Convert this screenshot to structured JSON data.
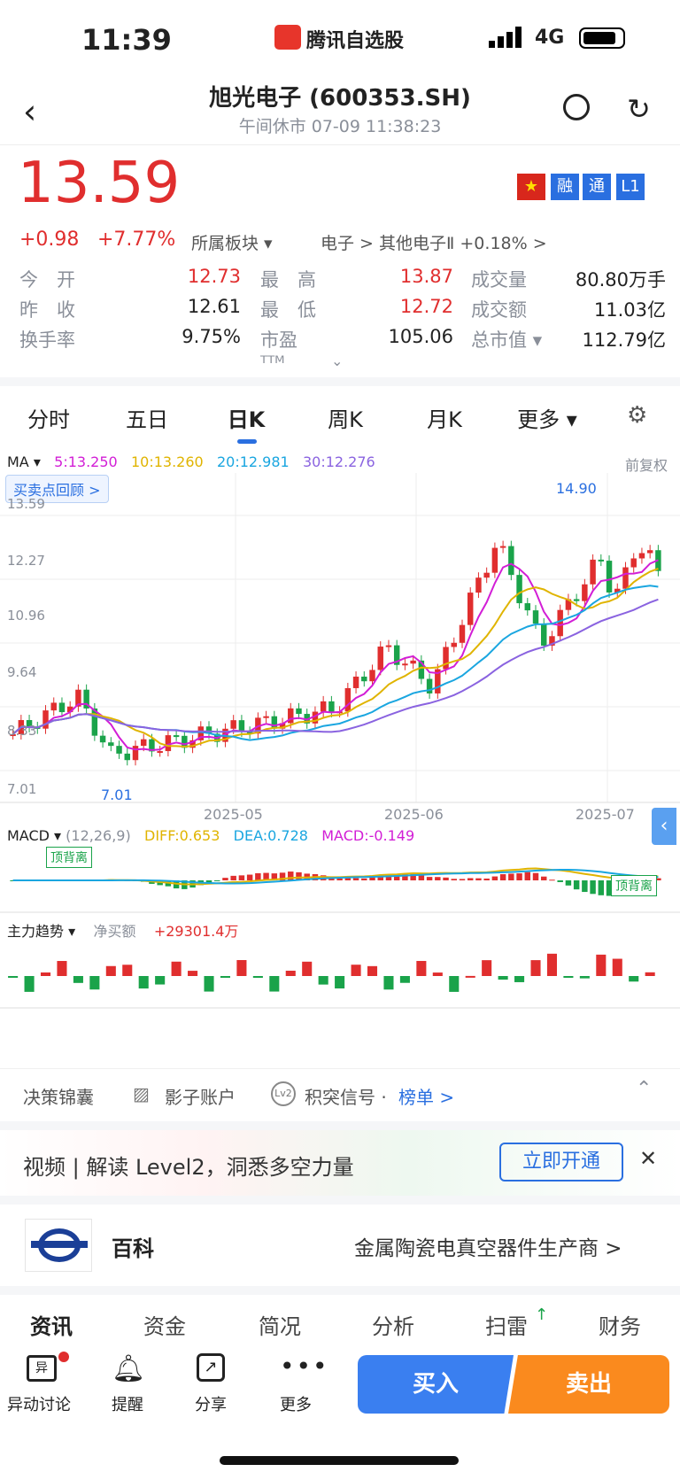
{
  "status": {
    "time": "11:39",
    "app_name": "腾讯自选股",
    "network": "4G"
  },
  "header": {
    "title": "旭光电子 (600353.SH)",
    "subtitle": "午间休市  07-09 11:38:23"
  },
  "quote": {
    "price": "13.59",
    "change": "+0.98",
    "change_pct": "+7.77%",
    "sector_label": "所属板块",
    "sector_path": "电子 >  其他电子Ⅱ +0.18% >",
    "badges": [
      "融",
      "通",
      "L1"
    ],
    "rows": [
      {
        "l1": "今　开",
        "v1": "12.73",
        "l2": "最　高",
        "v2": "13.87",
        "l3": "成交量",
        "v3": "80.80万手"
      },
      {
        "l1": "昨　收",
        "v1": "12.61",
        "l2": "最　低",
        "v2": "12.72",
        "l3": "成交额",
        "v3": "11.03亿"
      },
      {
        "l1": "换手率",
        "v1": "9.75%",
        "l2": "市盈ᵀᵀᴹ",
        "v2": "105.06",
        "l3": "总市值 ▾",
        "v3": "112.79亿"
      }
    ]
  },
  "tabs": [
    "分时",
    "五日",
    "日K",
    "周K",
    "月K",
    "更多 ▾"
  ],
  "active_tab": 2,
  "chart": {
    "ma_label": "MA ▾",
    "ma5": "5:13.250",
    "ma10": "10:13.260",
    "ma20": "20:12.981",
    "ma30": "30:12.276",
    "adjust": "前复权",
    "review_btn": "买卖点回顾 >",
    "y_ticks": [
      "13.59",
      "12.27",
      "10.96",
      "9.64",
      "8.33",
      "7.01"
    ],
    "x_ticks": [
      "2025-05",
      "2025-06",
      "2025-07"
    ],
    "high_label": "14.90",
    "low_label": "7.01",
    "macd_title": "MACD ▾",
    "macd_params": "(12,26,9)",
    "diff": "DIFF:0.653",
    "dea": "DEA:0.728",
    "macd": "MACD:-0.149",
    "top_div1": "顶背离",
    "top_div2": "顶背离",
    "main_title": "主力趋势 ▾",
    "net_label": "净买额",
    "net_value": "+29301.4万"
  },
  "chart_data": {
    "type": "candlestick",
    "title": "",
    "ylim": [
      7.01,
      14.9
    ],
    "last_close": 13.59,
    "x_ticks": [
      "2025-05",
      "2025-06",
      "2025-07"
    ]
  },
  "tools": {
    "t1": "决策锦囊",
    "t2": "影子账户",
    "t3": "积突信号 · ",
    "t4": "榜单 >"
  },
  "banner": {
    "text": "视频 | 解读 Level2，洞悉多空力量",
    "btn": "立即开通"
  },
  "baike": {
    "label": "百科",
    "desc": "金属陶瓷电真空器件生产商 >"
  },
  "info_tabs": [
    "资讯",
    "资金",
    "简况",
    "分析",
    "扫雷",
    "财务"
  ],
  "bottom": {
    "b1": "异动讨论",
    "b2": "提醒",
    "b3": "分享",
    "b4": "更多",
    "buy": "买入",
    "sell": "卖出"
  }
}
